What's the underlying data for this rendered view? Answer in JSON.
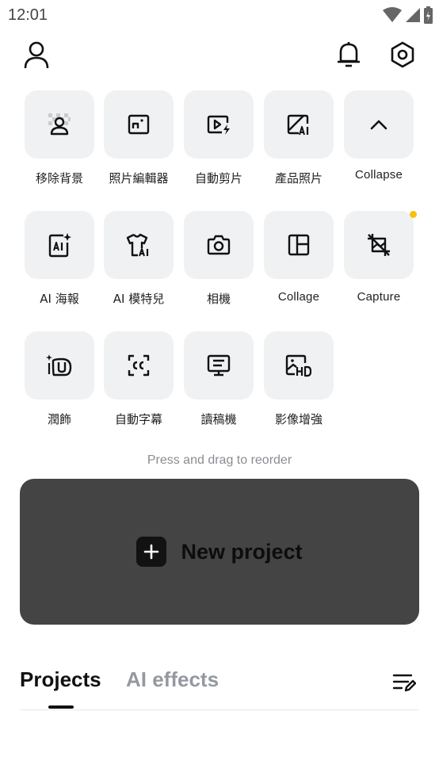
{
  "status": {
    "time": "12:01"
  },
  "tools": [
    {
      "label": "移除背景",
      "icon": "remove-background-icon"
    },
    {
      "label": "照片編輯器",
      "icon": "photo-editor-icon"
    },
    {
      "label": "自動剪片",
      "icon": "auto-cut-icon"
    },
    {
      "label": "產品照片",
      "icon": "product-photo-icon"
    },
    {
      "label": "Collapse",
      "icon": "chevron-up-icon"
    },
    {
      "label": "AI 海報",
      "icon": "ai-poster-icon"
    },
    {
      "label": "AI 模特兒",
      "icon": "ai-model-icon"
    },
    {
      "label": "相機",
      "icon": "camera-icon"
    },
    {
      "label": "Collage",
      "icon": "collage-icon"
    },
    {
      "label": "Capture",
      "icon": "capture-icon"
    },
    {
      "label": "潤飾",
      "icon": "retouch-icon"
    },
    {
      "label": "自動字幕",
      "icon": "auto-captions-icon"
    },
    {
      "label": "讀稿機",
      "icon": "teleprompter-icon"
    },
    {
      "label": "影像增強",
      "icon": "image-enhance-icon"
    }
  ],
  "hint": "Press and drag to reorder",
  "new_project": {
    "label": "New project"
  },
  "tabs": {
    "projects": "Projects",
    "ai_effects": "AI effects"
  },
  "colors": {
    "accent_dot": "#f6c112",
    "card_bg": "#444444",
    "tile_bg": "#eff1f3"
  }
}
